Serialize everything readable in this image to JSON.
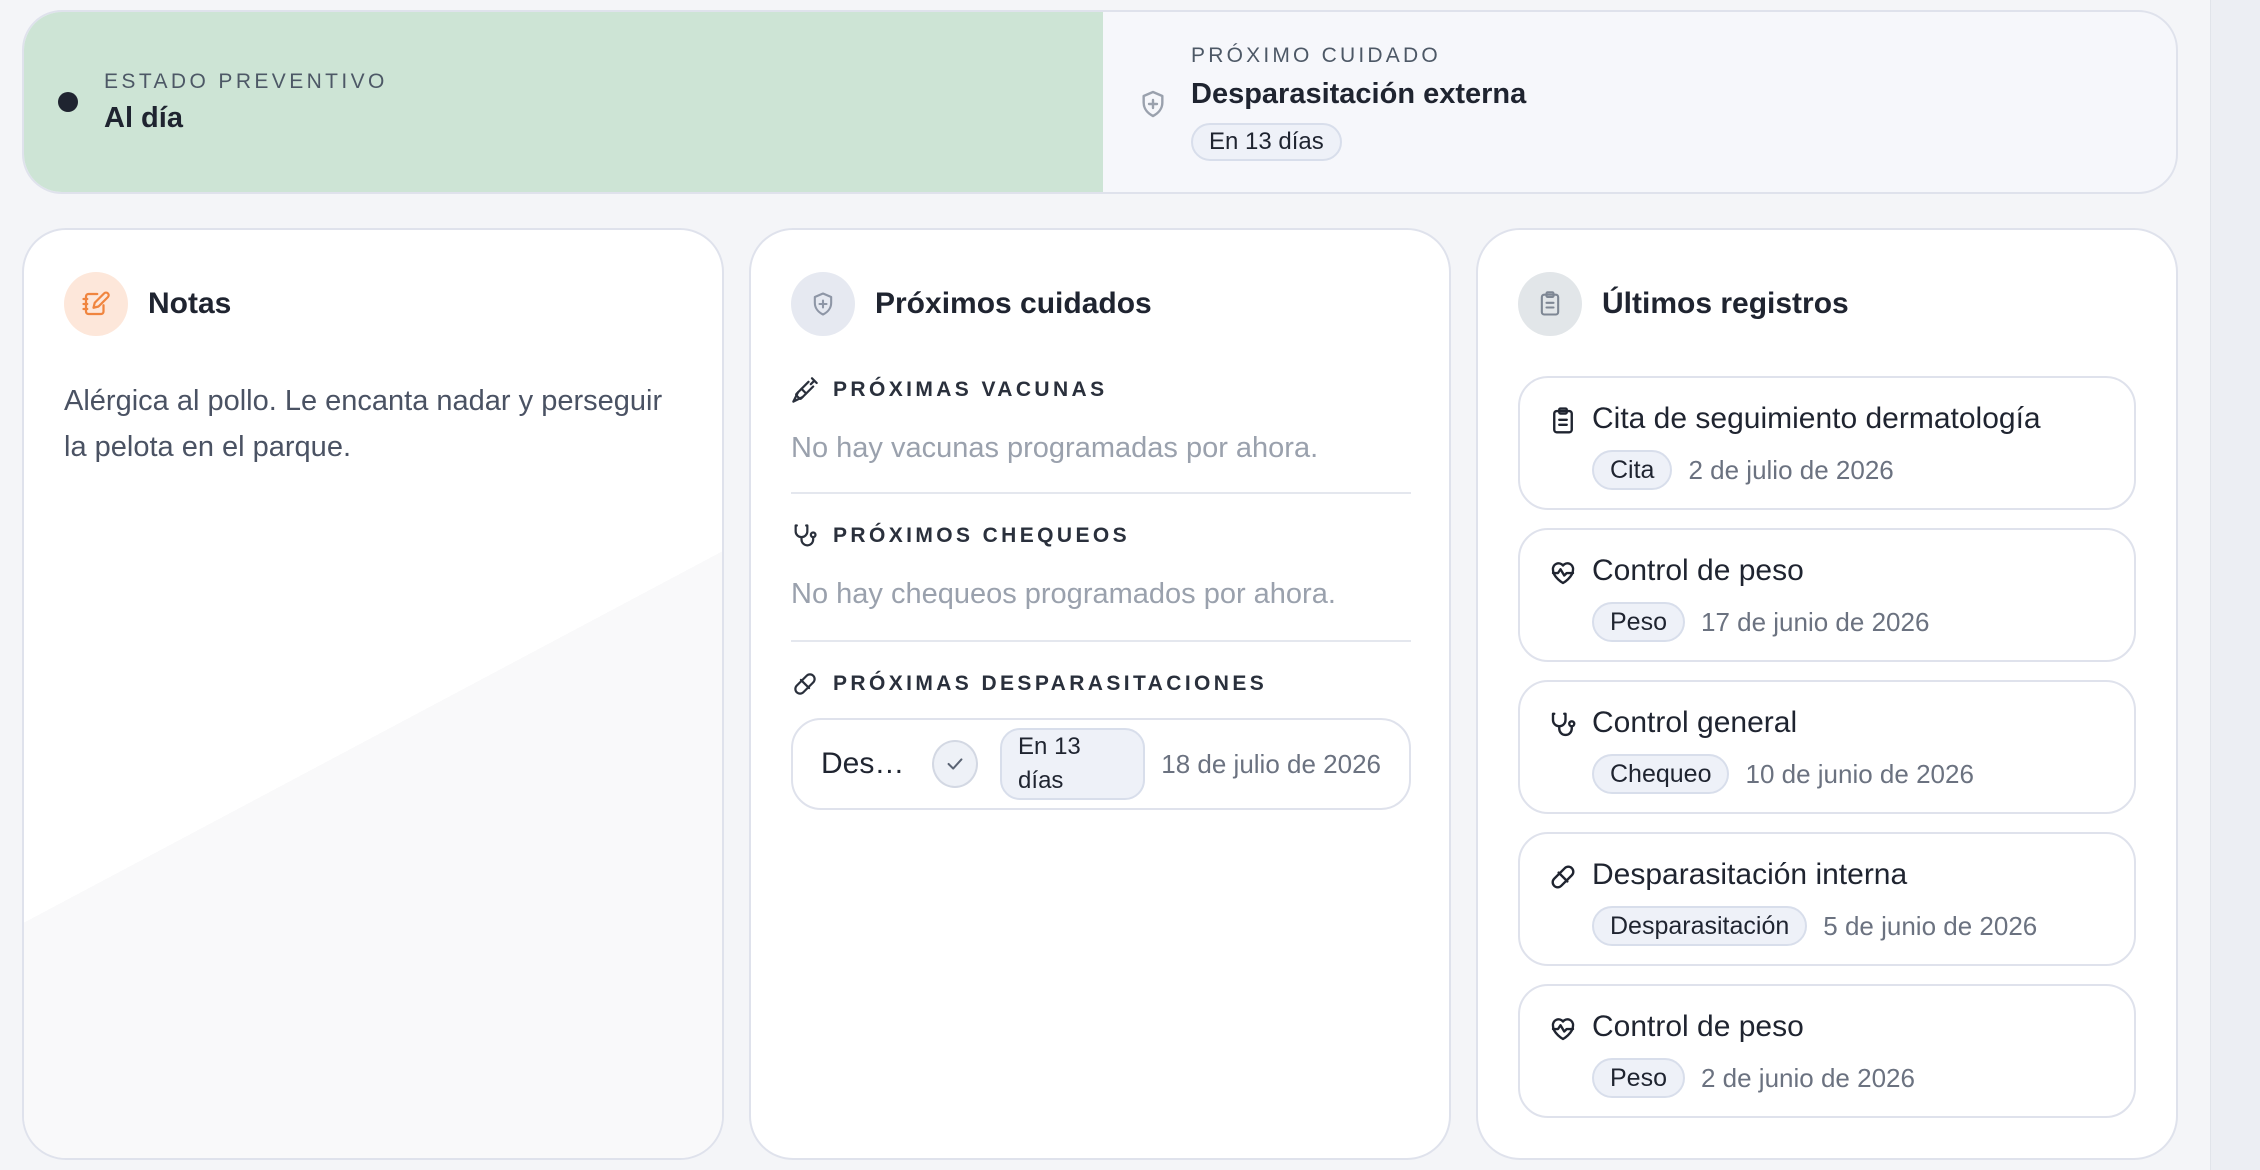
{
  "status": {
    "kicker": "ESTADO PREVENTIVO",
    "value": "Al día",
    "status_color": "#cde4d5"
  },
  "next_care": {
    "kicker": "PRÓXIMO CUIDADO",
    "title": "Desparasitación externa",
    "badge": "En 13 días",
    "icon": "shield-plus-icon"
  },
  "notes": {
    "title": "Notas",
    "icon": "notebook-pen-icon",
    "accent": "#f0853f",
    "text": "Alérgica al pollo. Le encanta nadar y perseguir la pelota en el parque."
  },
  "upcoming": {
    "title": "Próximos cuidados",
    "icon": "shield-plus-icon",
    "vaccines": {
      "label": "PRÓXIMAS VACUNAS",
      "icon": "syringe-icon",
      "empty": "No hay vacunas programadas por ahora."
    },
    "checkups": {
      "label": "PRÓXIMOS CHEQUEOS",
      "icon": "stethoscope-icon",
      "empty": "No hay chequeos programados por ahora."
    },
    "dewormings": {
      "label": "PRÓXIMAS DESPARASITACIONES",
      "icon": "pill-icon",
      "items": [
        {
          "name": "Desp…",
          "badge": "En 13 días",
          "date": "18 de julio de 2026"
        }
      ]
    }
  },
  "records": {
    "title": "Últimos registros",
    "icon": "clipboard-list-icon",
    "items": [
      {
        "title": "Cita de seguimiento dermatología",
        "badge": "Cita",
        "date": "2 de julio de 2026",
        "icon": "clipboard-list-icon"
      },
      {
        "title": "Control de peso",
        "badge": "Peso",
        "date": "17 de junio de 2026",
        "icon": "heart-pulse-icon"
      },
      {
        "title": "Control general",
        "badge": "Chequeo",
        "date": "10 de junio de 2026",
        "icon": "stethoscope-icon"
      },
      {
        "title": "Desparasitación interna",
        "badge": "Desparasitación",
        "date": "5 de junio de 2026",
        "icon": "pill-icon"
      },
      {
        "title": "Control de peso",
        "badge": "Peso",
        "date": "2 de junio de 2026",
        "icon": "heart-pulse-icon"
      }
    ]
  }
}
